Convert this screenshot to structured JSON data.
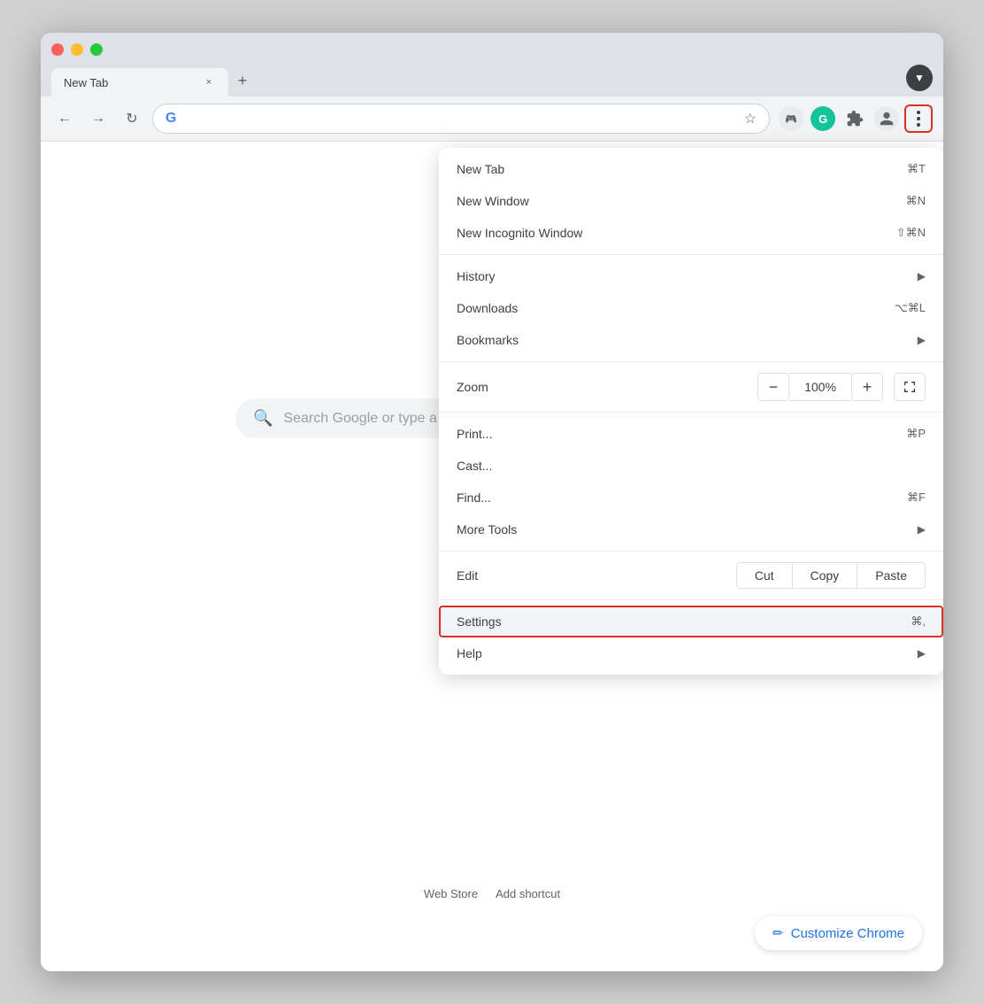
{
  "window": {
    "title": "New Tab"
  },
  "traffic_lights": {
    "close": "close",
    "minimize": "minimize",
    "maximize": "maximize"
  },
  "tab": {
    "title": "New Tab",
    "close_label": "×"
  },
  "toolbar": {
    "back_icon": "←",
    "forward_icon": "→",
    "reload_icon": "↻",
    "address_placeholder": "",
    "address_value": "G",
    "star_icon": "☆",
    "new_tab_icon": "+",
    "profile_down_icon": "▼"
  },
  "google": {
    "logo_letter": "G",
    "search_placeholder": "Search Google or type a URL"
  },
  "shortcuts": {
    "web_store": "Web Store",
    "add_shortcut": "Add shortcut"
  },
  "customize_btn": {
    "icon": "✏",
    "label": "Customize Chrome"
  },
  "menu": {
    "sections": [
      {
        "items": [
          {
            "label": "New Tab",
            "shortcut": "⌘T",
            "has_arrow": false
          },
          {
            "label": "New Window",
            "shortcut": "⌘N",
            "has_arrow": false
          },
          {
            "label": "New Incognito Window",
            "shortcut": "⇧⌘N",
            "has_arrow": false
          }
        ]
      },
      {
        "items": [
          {
            "label": "History",
            "shortcut": "",
            "has_arrow": true
          },
          {
            "label": "Downloads",
            "shortcut": "⌥⌘L",
            "has_arrow": false
          },
          {
            "label": "Bookmarks",
            "shortcut": "",
            "has_arrow": true
          }
        ]
      },
      {
        "is_zoom": true,
        "zoom_label": "Zoom",
        "zoom_minus": "−",
        "zoom_value": "100%",
        "zoom_plus": "+",
        "fullscreen_icon": "⛶"
      },
      {
        "items": [
          {
            "label": "Print...",
            "shortcut": "⌘P",
            "has_arrow": false
          },
          {
            "label": "Cast...",
            "shortcut": "",
            "has_arrow": false
          },
          {
            "label": "Find...",
            "shortcut": "⌘F",
            "has_arrow": false
          },
          {
            "label": "More Tools",
            "shortcut": "",
            "has_arrow": true
          }
        ]
      },
      {
        "is_edit": true,
        "edit_label": "Edit",
        "cut_label": "Cut",
        "copy_label": "Copy",
        "paste_label": "Paste"
      },
      {
        "items": [
          {
            "label": "Settings",
            "shortcut": "⌘,",
            "has_arrow": false,
            "highlighted": true
          },
          {
            "label": "Help",
            "shortcut": "",
            "has_arrow": true
          }
        ]
      }
    ]
  },
  "colors": {
    "accent_blue": "#4285f4",
    "highlight_red": "#d93025",
    "menu_hover": "#f1f3f4",
    "text_primary": "#3c4043",
    "text_secondary": "#5f6368"
  }
}
